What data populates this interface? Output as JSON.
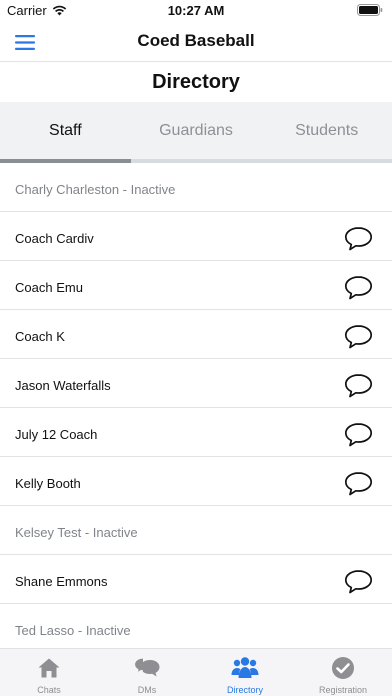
{
  "status": {
    "carrier": "Carrier",
    "time": "10:27 AM"
  },
  "nav": {
    "title": "Coed Baseball"
  },
  "page": {
    "title": "Directory"
  },
  "tabs": [
    {
      "label": "Staff",
      "active": true
    },
    {
      "label": "Guardians",
      "active": false
    },
    {
      "label": "Students",
      "active": false
    }
  ],
  "staff": [
    {
      "name": "Charly Charleston - Inactive",
      "inactive": true
    },
    {
      "name": "Coach Cardiv",
      "inactive": false
    },
    {
      "name": "Coach Emu",
      "inactive": false
    },
    {
      "name": "Coach K",
      "inactive": false
    },
    {
      "name": "Jason Waterfalls",
      "inactive": false
    },
    {
      "name": "July 12 Coach",
      "inactive": false
    },
    {
      "name": "Kelly Booth",
      "inactive": false
    },
    {
      "name": "Kelsey Test - Inactive",
      "inactive": true
    },
    {
      "name": "Shane Emmons",
      "inactive": false
    },
    {
      "name": "Ted Lasso - Inactive",
      "inactive": true
    }
  ],
  "tabbar": [
    {
      "label": "Chats",
      "icon": "home-icon",
      "active": false
    },
    {
      "label": "DMs",
      "icon": "chat-bubbles-icon",
      "active": false
    },
    {
      "label": "Directory",
      "icon": "people-group-icon",
      "active": true
    },
    {
      "label": "Registration",
      "icon": "check-circle-icon",
      "active": false
    }
  ],
  "colors": {
    "accent": "#2a78e4",
    "inactive_text": "#808489",
    "tab_bg": "#f1f2f4",
    "indicator": "#8a8e94"
  }
}
